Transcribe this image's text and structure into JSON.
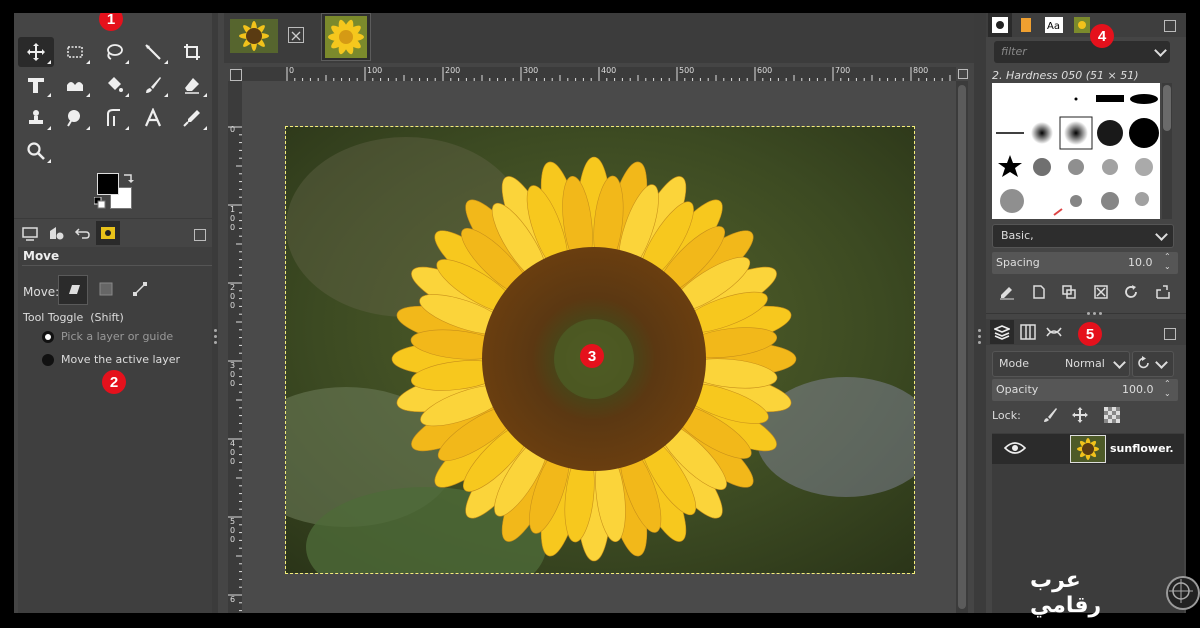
{
  "tabs": {
    "images": [
      {
        "name": "sunflower-thumbnail-1"
      },
      {
        "name": "sunflower-thumbnail-2"
      }
    ]
  },
  "badges": [
    "1",
    "2",
    "3",
    "4",
    "5"
  ],
  "tool_options": {
    "title": "Move",
    "move_label": "Move:",
    "toggle_label": "Tool Toggle  (Shift)",
    "option_pick": "Pick a layer or guide",
    "option_move_active": "Move the active layer"
  },
  "rulers": {
    "top": [
      "0",
      "100",
      "200",
      "300",
      "400",
      "500",
      "600",
      "700",
      "800"
    ],
    "left": [
      "0",
      "1\n0\n0",
      "2\n0\n0",
      "3\n0\n0",
      "4\n0\n0",
      "5\n0\n0",
      "6"
    ]
  },
  "brushes": {
    "filter_placeholder": "filter",
    "current_brush": "2. Hardness 050 (51 × 51)",
    "preset": "Basic,",
    "spacing_label": "Spacing",
    "spacing_value": "10.0"
  },
  "layers": {
    "mode_label": "Mode",
    "mode_value": "Normal",
    "opacity_label": "Opacity",
    "opacity_value": "100.0",
    "lock_label": "Lock:",
    "layer_name": "sunflower."
  },
  "watermark": "عرب رقامي",
  "colors": {
    "accent_badge": "#e5111c",
    "selection": "#f4ee7a",
    "panel": "#454545"
  }
}
